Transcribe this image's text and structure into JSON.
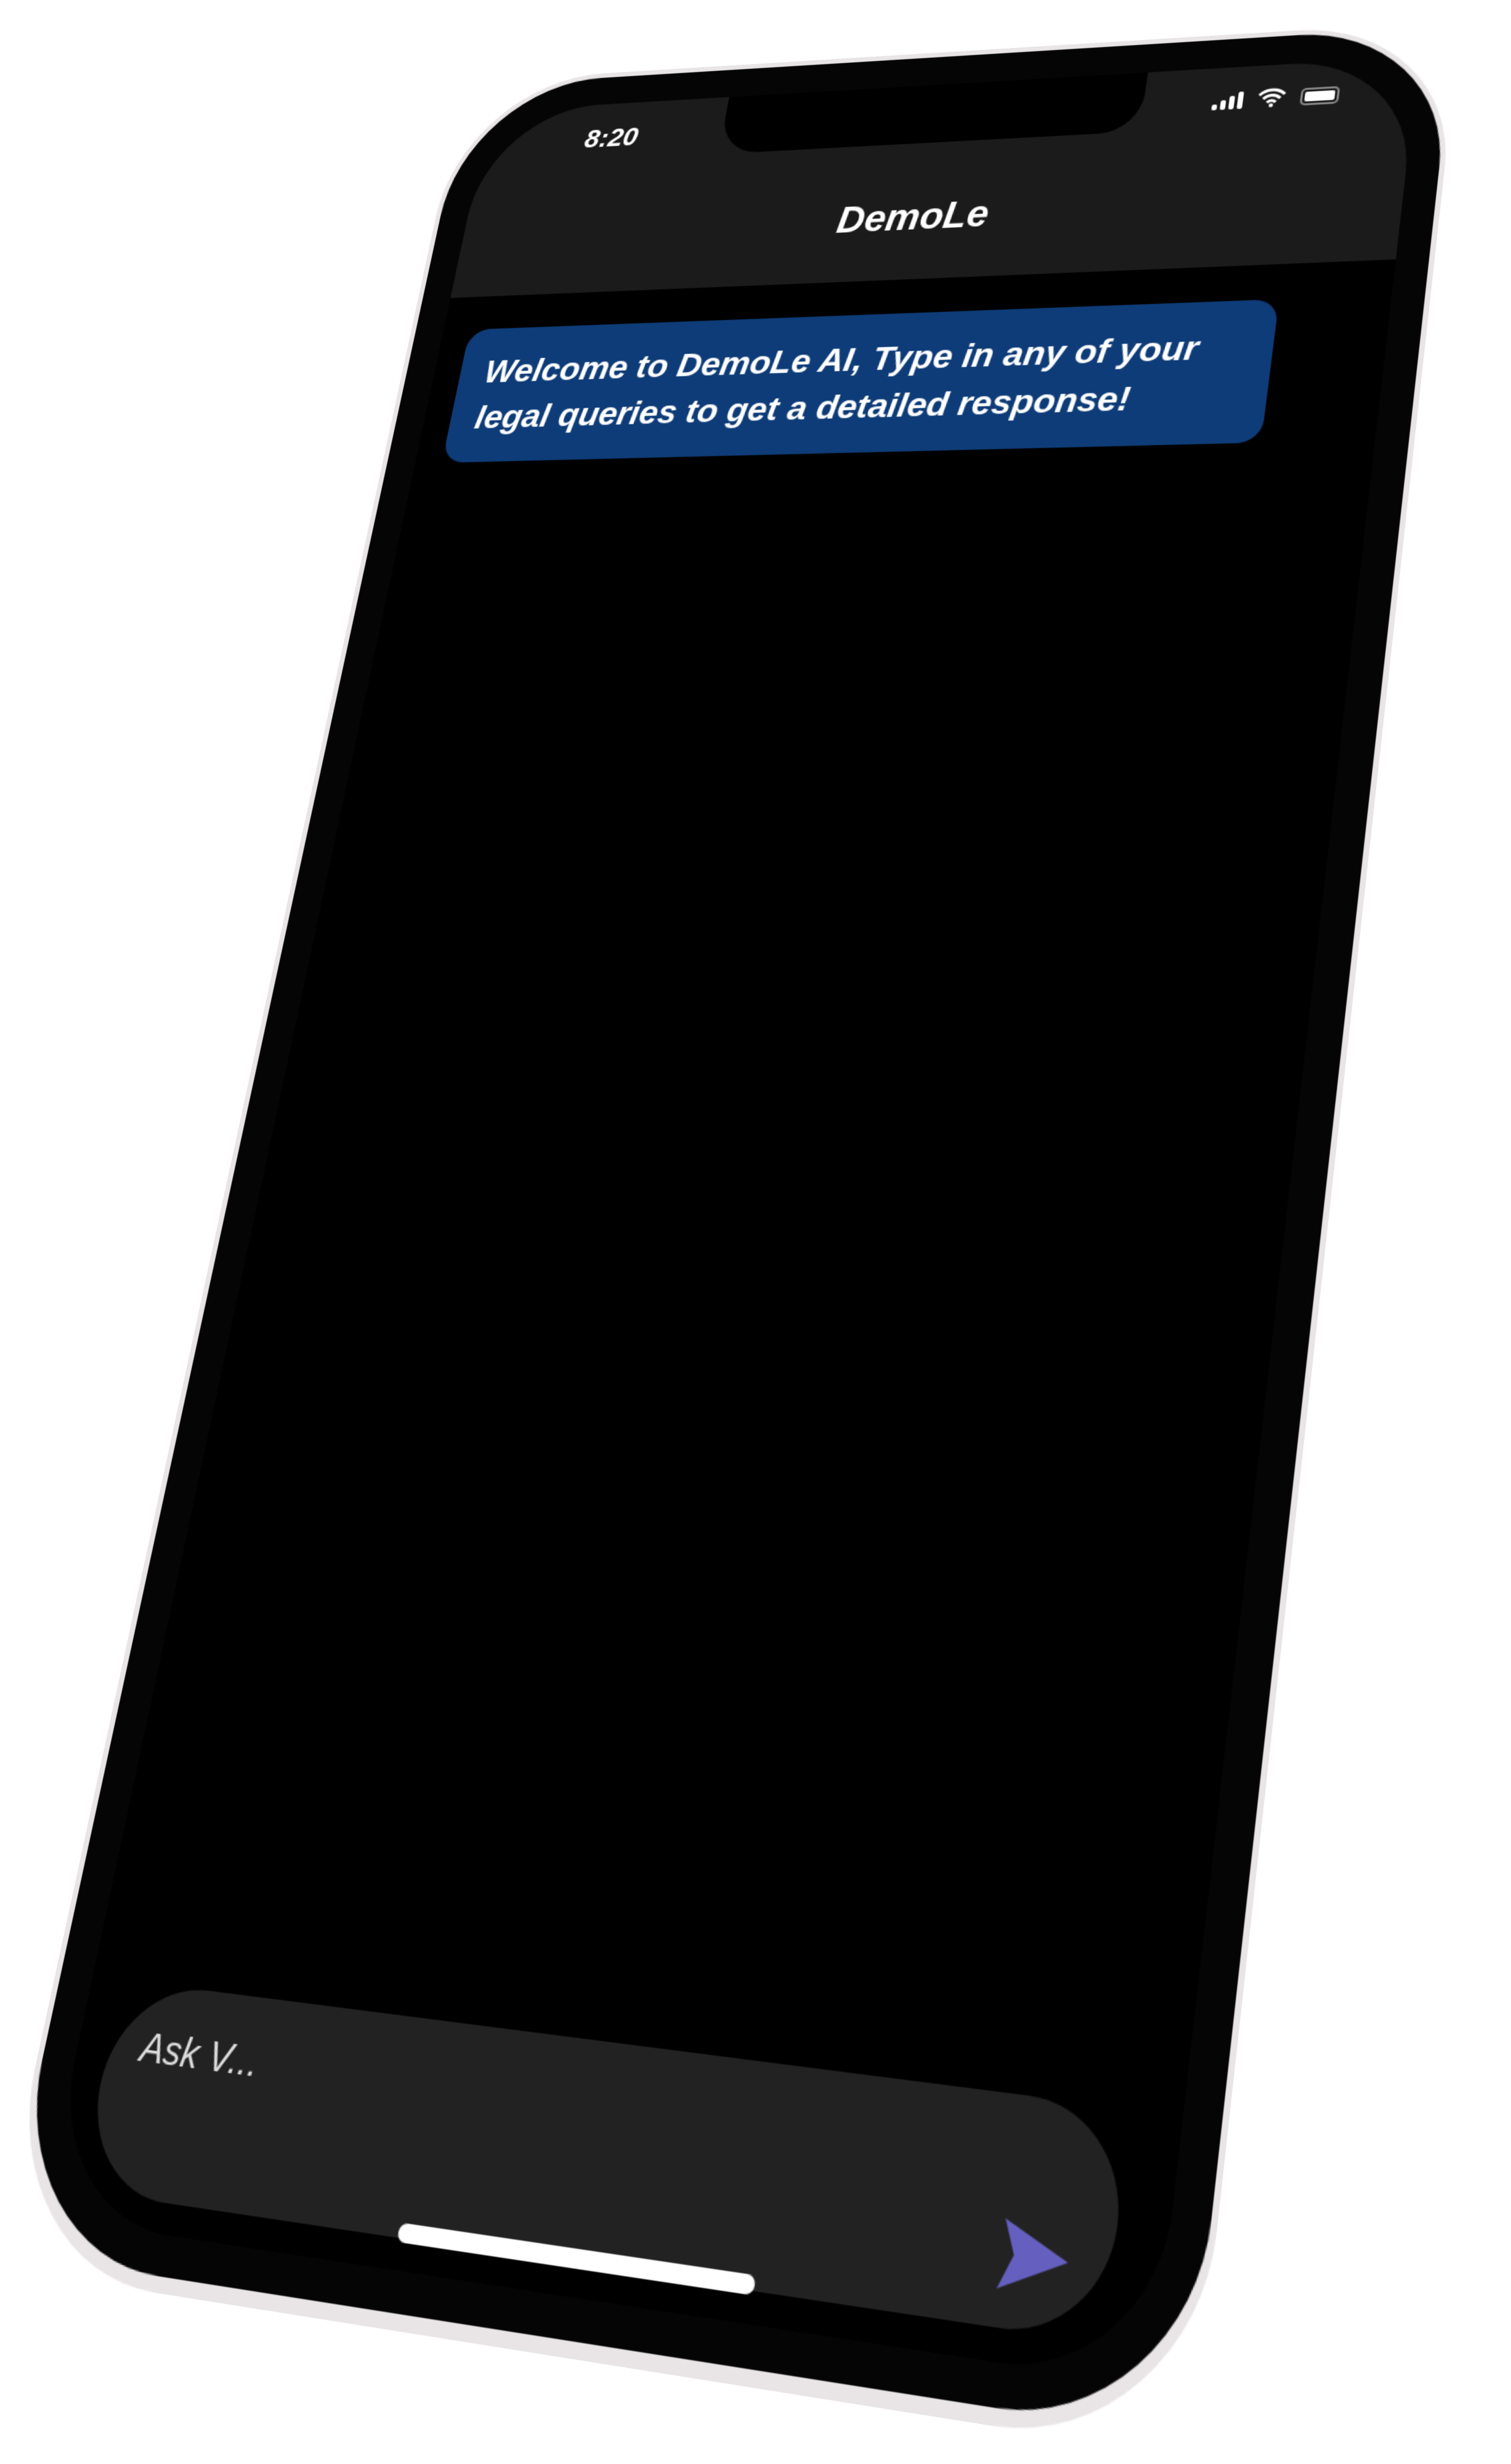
{
  "status_bar": {
    "time": "8:20",
    "icons": [
      "signal-icon",
      "wifi-icon",
      "battery-icon"
    ]
  },
  "app_bar": {
    "title": "DemoLe"
  },
  "messages": [
    {
      "sender": "bot",
      "text": "Welcome to DemoLe AI, Type in any of your legal queries to get a detailed response!"
    }
  ],
  "composer": {
    "placeholder": "Ask V...",
    "send_icon": "send-icon"
  },
  "colors": {
    "bubble": "#0e3c78",
    "send": "#6560c0",
    "appbar": "#1b1b1b",
    "input": "#222222"
  }
}
